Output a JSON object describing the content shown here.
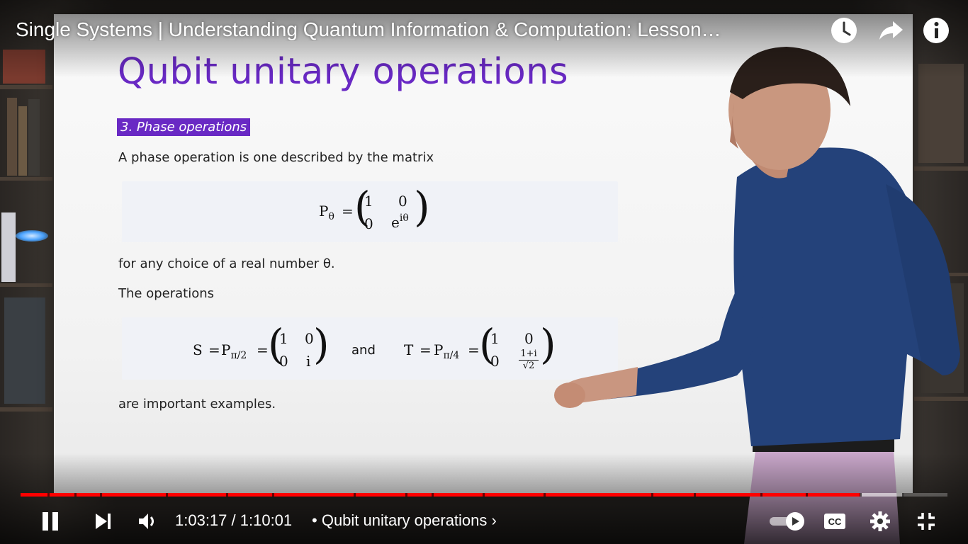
{
  "player": {
    "video_title": "Single Systems | Understanding Quantum Information & Computation: Lesson…",
    "current_time": "1:03:17",
    "time_separator": " / ",
    "duration": "1:10:01",
    "chapter_prefix": "•",
    "chapter_title": "Qubit unitary operations",
    "chapter_chevron": "›",
    "progress_fraction": 0.906,
    "buffered_fraction": 0.953,
    "icons": {
      "watch_later": "clock-icon",
      "share": "share-arrow-icon",
      "info": "info-icon",
      "pause": "pause-icon",
      "next": "skip-next-icon",
      "volume": "volume-icon",
      "autoplay": "autoplay-toggle-icon",
      "captions": "cc-icon",
      "settings": "gear-icon",
      "fullscreen_exit": "exit-fullscreen-icon"
    },
    "captions_label": "CC",
    "accent_color": "#ff0000"
  },
  "slide": {
    "title": "Qubit unitary operations",
    "section_badge": "3. Phase operations",
    "para1": "A phase operation is one described by the matrix",
    "para2": "for any choice of a real number θ.",
    "para3": "The operations",
    "para4": "are important examples.",
    "title_color": "#6929c4",
    "eq1": {
      "lhs": "P",
      "lhs_sub": "θ",
      "equals": "=",
      "m11": "1",
      "m12": "0",
      "m21": "0",
      "m22_base": "e",
      "m22_sup": "iθ"
    },
    "eq2": {
      "s_lhs": "S",
      "s_p": "P",
      "s_sub": "π/2",
      "equals": "=",
      "s_m11": "1",
      "s_m12": "0",
      "s_m21": "0",
      "s_m22": "i",
      "and": "and",
      "t_lhs": "T",
      "t_p": "P",
      "t_sub": "π/4",
      "t_m11": "1",
      "t_m12": "0",
      "t_m21": "0",
      "t_m22_num": "1+i",
      "t_m22_den": "√2"
    }
  }
}
